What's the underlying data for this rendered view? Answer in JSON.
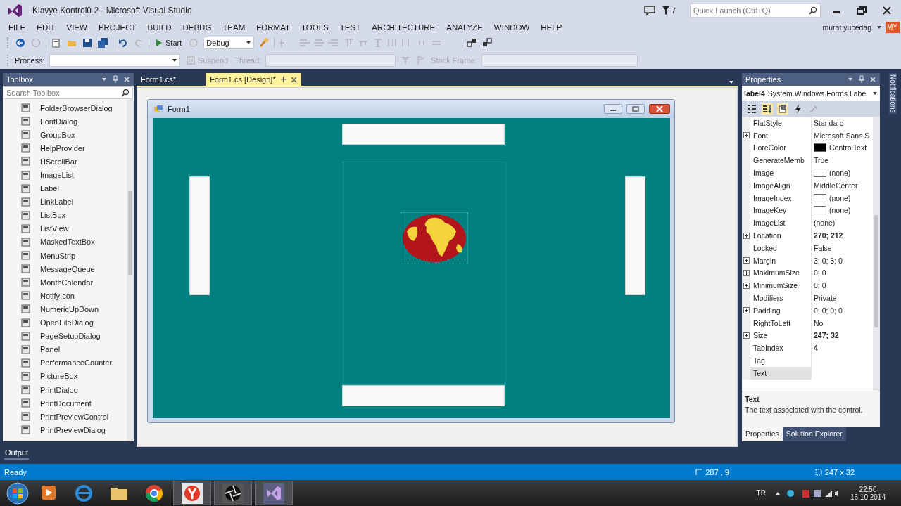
{
  "window": {
    "title": "Klavye Kontrolü 2 - Microsoft Visual Studio",
    "notification_count": "7",
    "quick_launch": {
      "placeholder": "Quick Launch (Ctrl+Q)"
    }
  },
  "menu": [
    "FILE",
    "EDIT",
    "VIEW",
    "PROJECT",
    "BUILD",
    "DEBUG",
    "TEAM",
    "FORMAT",
    "TOOLS",
    "TEST",
    "ARCHITECTURE",
    "ANALYZE",
    "WINDOW",
    "HELP"
  ],
  "account": {
    "user": "murat yücedağ",
    "initials": "MY"
  },
  "toolbar": {
    "start": "Start",
    "configuration": "Debug"
  },
  "debug_toolbar": {
    "process_label": "Process:",
    "suspend": "Suspend",
    "thread_label": "Thread:",
    "stack_frame_label": "Stack Frame:"
  },
  "toolbox": {
    "title": "Toolbox",
    "search": {
      "placeholder": "Search Toolbox"
    },
    "items": [
      "FolderBrowserDialog",
      "FontDialog",
      "GroupBox",
      "HelpProvider",
      "HScrollBar",
      "ImageList",
      "Label",
      "LinkLabel",
      "ListBox",
      "ListView",
      "MaskedTextBox",
      "MenuStrip",
      "MessageQueue",
      "MonthCalendar",
      "NotifyIcon",
      "NumericUpDown",
      "OpenFileDialog",
      "PageSetupDialog",
      "Panel",
      "PerformanceCounter",
      "PictureBox",
      "PrintDialog",
      "PrintDocument",
      "PrintPreviewControl",
      "PrintPreviewDialog"
    ]
  },
  "editor_tabs": [
    {
      "label": "Form1.cs*",
      "selected": false
    },
    {
      "label": "Form1.cs [Design]*",
      "selected": true
    }
  ],
  "designer": {
    "form_title": "Form1"
  },
  "properties": {
    "title": "Properties",
    "object_name": "label4",
    "object_type": "System.Windows.Forms.Labe",
    "rows": [
      {
        "name": "FlatStyle",
        "value": "Standard",
        "kind": "text",
        "expandable": false,
        "bold": false,
        "selected": false
      },
      {
        "name": "Font",
        "value": "Microsoft Sans S",
        "kind": "text",
        "expandable": true,
        "bold": false,
        "selected": false
      },
      {
        "name": "ForeColor",
        "value": "ControlText",
        "kind": "color",
        "color": "#000000",
        "expandable": false,
        "bold": false,
        "selected": false
      },
      {
        "name": "GenerateMemb",
        "value": "True",
        "kind": "text",
        "expandable": false,
        "bold": false,
        "selected": false
      },
      {
        "name": "Image",
        "value": "(none)",
        "kind": "image",
        "expandable": false,
        "bold": false,
        "selected": false
      },
      {
        "name": "ImageAlign",
        "value": "MiddleCenter",
        "kind": "text",
        "expandable": false,
        "bold": false,
        "selected": false
      },
      {
        "name": "ImageIndex",
        "value": "(none)",
        "kind": "image",
        "expandable": false,
        "bold": false,
        "selected": false
      },
      {
        "name": "ImageKey",
        "value": "(none)",
        "kind": "image",
        "expandable": false,
        "bold": false,
        "selected": false
      },
      {
        "name": "ImageList",
        "value": "(none)",
        "kind": "text",
        "expandable": false,
        "bold": false,
        "selected": false
      },
      {
        "name": "Location",
        "value": "270; 212",
        "kind": "text",
        "expandable": true,
        "bold": true,
        "selected": false
      },
      {
        "name": "Locked",
        "value": "False",
        "kind": "text",
        "expandable": false,
        "bold": false,
        "selected": false
      },
      {
        "name": "Margin",
        "value": "3; 0; 3; 0",
        "kind": "text",
        "expandable": true,
        "bold": false,
        "selected": false
      },
      {
        "name": "MaximumSize",
        "value": "0; 0",
        "kind": "text",
        "expandable": true,
        "bold": false,
        "selected": false
      },
      {
        "name": "MinimumSize",
        "value": "0; 0",
        "kind": "text",
        "expandable": true,
        "bold": false,
        "selected": false
      },
      {
        "name": "Modifiers",
        "value": "Private",
        "kind": "text",
        "expandable": false,
        "bold": false,
        "selected": false
      },
      {
        "name": "Padding",
        "value": "0; 0; 0; 0",
        "kind": "text",
        "expandable": true,
        "bold": false,
        "selected": false
      },
      {
        "name": "RightToLeft",
        "value": "No",
        "kind": "text",
        "expandable": false,
        "bold": false,
        "selected": false
      },
      {
        "name": "Size",
        "value": "247; 32",
        "kind": "text",
        "expandable": true,
        "bold": true,
        "selected": false
      },
      {
        "name": "TabIndex",
        "value": "4",
        "kind": "text",
        "expandable": false,
        "bold": true,
        "selected": false
      },
      {
        "name": "Tag",
        "value": "",
        "kind": "text",
        "expandable": false,
        "bold": false,
        "selected": false
      },
      {
        "name": "Text",
        "value": "",
        "kind": "text",
        "expandable": false,
        "bold": false,
        "selected": true
      }
    ],
    "description_title": "Text",
    "description": "The text associated with the control.",
    "tabs": [
      {
        "label": "Properties",
        "selected": true
      },
      {
        "label": "Solution Explorer",
        "selected": false
      }
    ]
  },
  "notifications_tab": "Notifications",
  "output_tab": "Output",
  "status_bar": {
    "text": "Ready",
    "position": "287 , 9",
    "size": "247 x 32"
  },
  "taskbar": {
    "language": "TR",
    "time": "22:50",
    "date": "16.10.2014"
  }
}
